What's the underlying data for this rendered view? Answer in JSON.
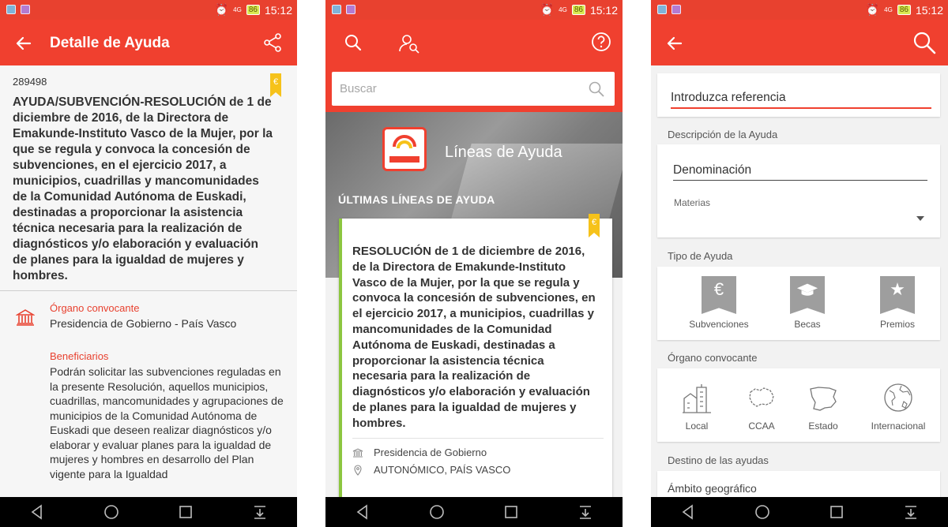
{
  "status": {
    "time": "15:12",
    "battery": "86",
    "network": "4G"
  },
  "panel1": {
    "title": "Detalle de Ayuda",
    "ref": "289498",
    "euro": "€",
    "heading": "AYUDA/SUBVENCIÓN-RESOLUCIÓN de 1 de diciembre de 2016, de la Directora de Emakunde-Instituto Vasco de la Mujer, por la que se regula y convoca la concesión de subvenciones, en el ejercicio 2017, a municipios, cuadrillas y mancomunidades de la Comunidad Autónoma de Euskadi, destinadas a proporcionar la asistencia técnica necesaria para la realización de diagnósticos y/o elaboración y evaluación de planes para la igualdad de mujeres y hombres.",
    "organo_label": "Órgano convocante",
    "organo_value": "Presidencia de Gobierno - País Vasco",
    "benef_label": "Beneficiarios",
    "benef_text": "Podrán solicitar las subvenciones reguladas en la presente Resolución, aquellos municipios, cuadrillas, mancomunidades y agrupaciones de municipios de la Comunidad Autónoma de Euskadi que deseen realizar diagnósticos y/o elaborar y evaluar planes para la igualdad de mujeres y hombres en desarrollo del Plan vigente para la Igualdad"
  },
  "panel2": {
    "search_placeholder": "Buscar",
    "hero_title": "Líneas de Ayuda",
    "hero_sub": "ÚLTIMAS LÍNEAS DE AYUDA",
    "euro": "€",
    "card_title": "RESOLUCIÓN de 1 de diciembre de 2016, de la Directora de Emakunde-Instituto Vasco de la Mujer, por la que se regula y convoca la concesión de subvenciones, en el ejercicio 2017, a municipios, cuadrillas y mancomunidades de la Comunidad Autónoma de Euskadi, destinadas a proporcionar la asistencia técnica necesaria para la realización de diagnósticos y/o elaboración y evaluación de planes para la igualdad de mujeres y hombres.",
    "card_org": "Presidencia de Gobierno",
    "card_loc": "AUTONÓMICO, PAÍS VASCO"
  },
  "panel3": {
    "ref_placeholder": "Introduzca referencia",
    "desc_title": "Descripción de la Ayuda",
    "denominacion": "Denominación",
    "materias": "Materias",
    "tipo_title": "Tipo de Ayuda",
    "tipo_items": [
      "Subvenciones",
      "Becas",
      "Premios"
    ],
    "organo_title": "Órgano convocante",
    "organo_items": [
      "Local",
      "CCAA",
      "Estado",
      "Internacional"
    ],
    "destino_title": "Destino de las ayudas",
    "ambito": "Ámbito geográfico"
  }
}
